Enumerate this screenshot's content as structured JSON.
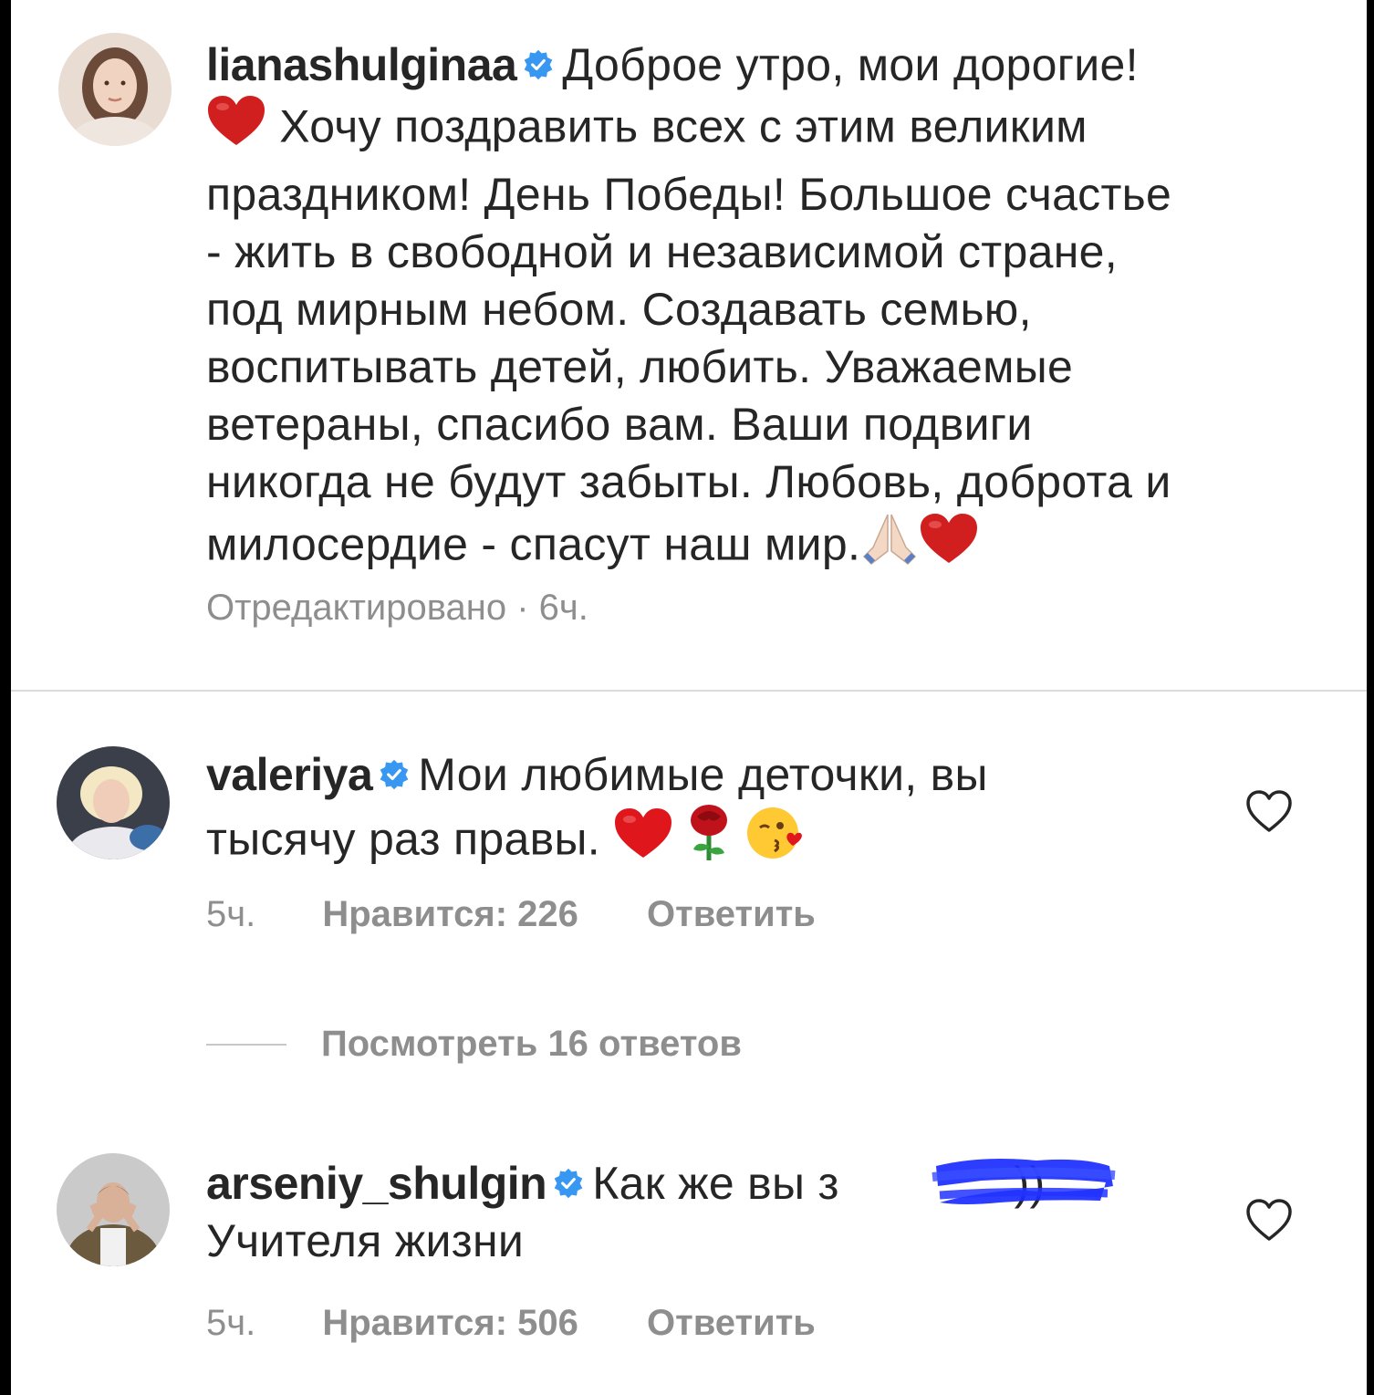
{
  "post_caption": {
    "username": "lianashulginaa",
    "text_lines": [
      "Доброе утро, мои дорогие!",
      "Хочу поздравить всех с этим великим",
      "праздником! День Победы! Большое счастье",
      "- жить в свободной и независимой стране,",
      "под мирным небом. Создавать семью,",
      "воспитывать детей, любить. Уважаемые",
      "ветераны, спасибо вам. Ваши подвиги",
      "никогда не будут забыты. Любовь, доброта и",
      "милосердие - спасут наш мир."
    ],
    "meta": "Отредактировано · 6ч."
  },
  "comments": [
    {
      "username": "valeriya",
      "text_line1": "Мои любимые деточки, вы",
      "text_line2": "тысячу раз правы.",
      "time": "5ч.",
      "likes_label": "Нравится: 226",
      "reply_label": "Ответить",
      "view_replies": "Посмотреть 16 ответов"
    },
    {
      "username": "arseniy_shulgin",
      "text_line1_start": "Как же вы з",
      "text_line1_end": "))",
      "text_line2": "Учителя жизни",
      "time": "5ч.",
      "likes_label": "Нравится: 506",
      "reply_label": "Ответить"
    }
  ],
  "colors": {
    "text": "#262626",
    "secondary": "#8e8e8e",
    "verified": "#3897f0",
    "scribble": "#1a2cff"
  },
  "icons": [
    "verified-badge-icon",
    "red-heart-icon",
    "folded-hands-icon",
    "rose-icon",
    "kissing-face-icon",
    "heart-outline-icon"
  ]
}
